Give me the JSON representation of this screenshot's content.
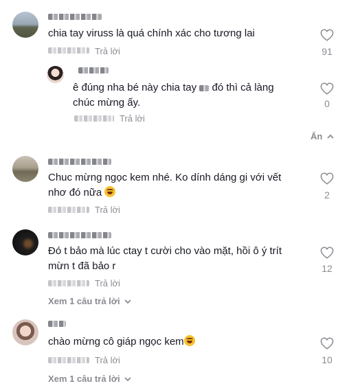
{
  "comments": [
    {
      "text": "chia tay viruss là quá chính xác cho tương lai",
      "reply_label": "Trả lời",
      "likes": "91",
      "replies": [
        {
          "text_line1": "ê đúng nha bé này chia tay",
          "text_line2": "đó thì cả làng",
          "text_line3": "chúc mừng ấy.",
          "reply_label": "Trả lời",
          "likes": "0"
        }
      ],
      "collapse_label": "Ẩn"
    },
    {
      "text_line1": "Chuc mừng ngọc kem nhé. Ko dính dáng gi với vết",
      "text_line2": "nhơ đó nữa",
      "reply_label": "Trả lời",
      "likes": "2"
    },
    {
      "text_line1": "Đó t bảo mà lúc ctay t cười cho vào mặt, hồi ô ý trít",
      "text_line2": "mừn t đã bảo r",
      "reply_label": "Trả lời",
      "likes": "12",
      "view_more": "Xem 1 câu trả lời"
    },
    {
      "text": "chào mừng cô giáp ngọc kem",
      "reply_label": "Trả lời",
      "likes": "10",
      "view_more": "Xem 1 câu trả lời"
    }
  ],
  "icons": {
    "like": "heart-outline-icon",
    "collapse": "chevron-up-icon",
    "expand": "chevron-down-icon",
    "emoji": "laughing-face-emoji"
  }
}
